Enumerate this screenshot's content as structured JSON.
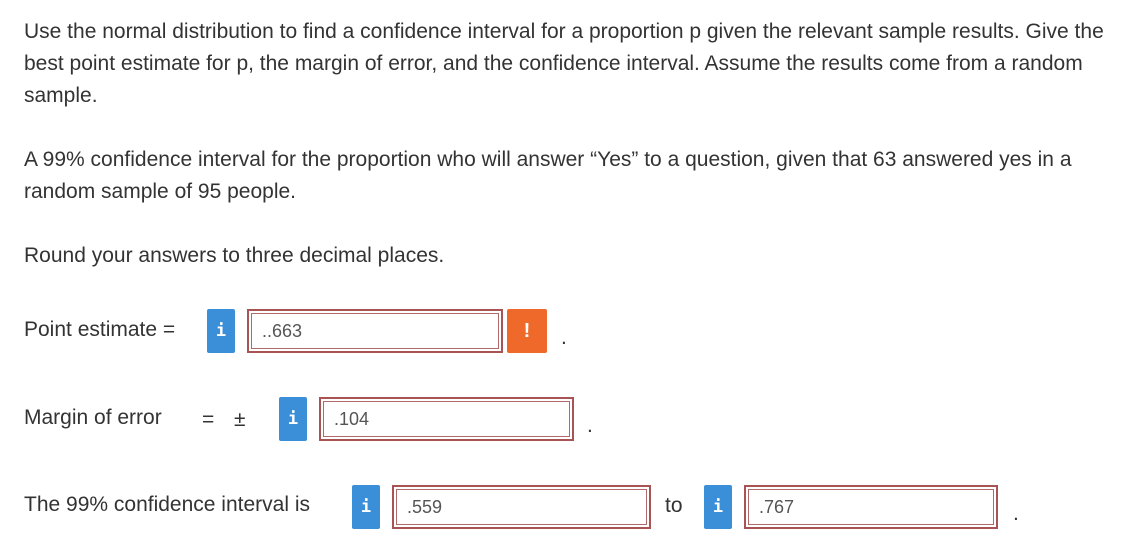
{
  "question": {
    "intro": "Use the normal distribution to find a confidence interval for a proportion p given the relevant sample results. Give the best point estimate for p, the margin of error, and the confidence interval. Assume the results come from a random sample.",
    "scenario": "A 99% confidence interval for the proportion who will answer “Yes” to a question, given that 63 answered yes in a random sample of 95 people.",
    "rounding": "Round your answers to three decimal places."
  },
  "point_estimate": {
    "label": "Point estimate =",
    "value": "..663",
    "info_icon": "i",
    "warning_icon": "!"
  },
  "margin_of_error": {
    "label": "Margin of error",
    "equals": "=",
    "plus_minus": "±",
    "value": ".104",
    "info_icon": "i"
  },
  "confidence_interval": {
    "label": "The 99% confidence interval is",
    "lower": ".559",
    "connector": "to",
    "upper": ".767",
    "info_icon": "i"
  },
  "punctuation": {
    "period": "."
  },
  "colors": {
    "info_button": "#3b8ed8",
    "warning_button": "#ef6a2a",
    "answer_border": "#a85454",
    "text": "#333333"
  }
}
